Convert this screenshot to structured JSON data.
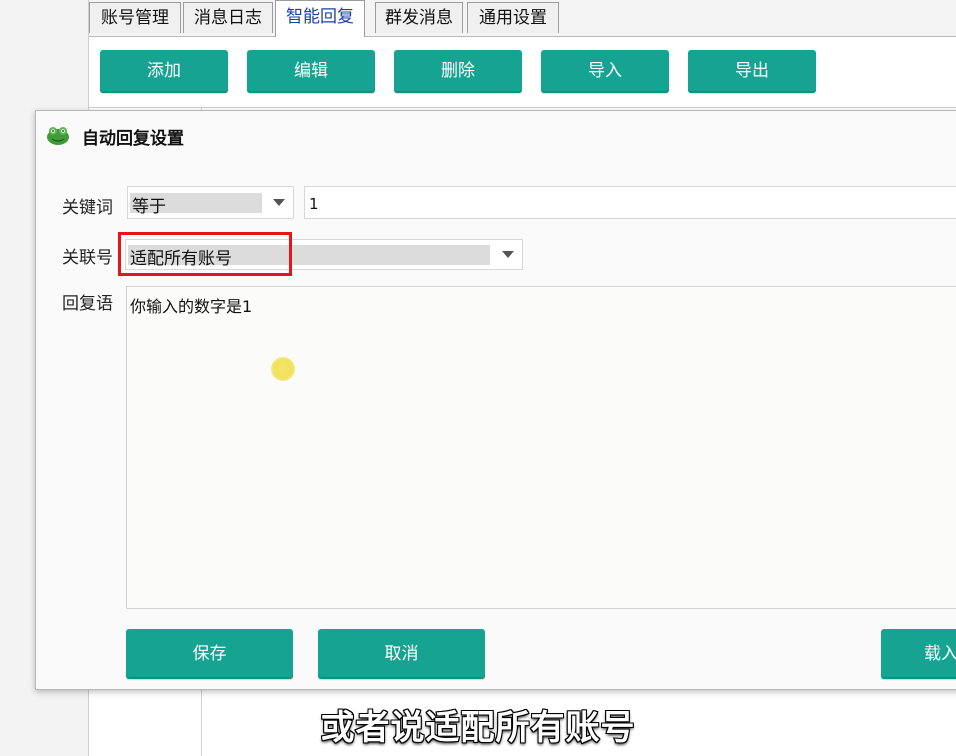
{
  "tabs": [
    {
      "label": "账号管理",
      "active": false
    },
    {
      "label": "消息日志",
      "active": false
    },
    {
      "label": "智能回复",
      "active": true
    },
    {
      "label": "群发消息",
      "active": false
    },
    {
      "label": "通用设置",
      "active": false
    }
  ],
  "toolbar": {
    "add_label": "添加",
    "edit_label": "编辑",
    "delete_label": "删除",
    "import_label": "导入",
    "export_label": "导出"
  },
  "dialog": {
    "title": "自动回复设置",
    "icon": "frog-app-icon",
    "keyword_label": "关键词",
    "keyword_match_selected": "等于",
    "keyword_value": "1",
    "account_label": "关联号",
    "account_selected": "适配所有账号",
    "reply_label": "回复语",
    "reply_value": "你输入的数字是1",
    "save_label": "保存",
    "cancel_label": "取消",
    "load_label": "载入"
  },
  "subtitle": "或者说适配所有账号",
  "colors": {
    "button_bg": "#17a392",
    "button_text": "#ffffff",
    "active_tab_text": "#1f3fa6",
    "highlight_border": "#e8141b"
  }
}
